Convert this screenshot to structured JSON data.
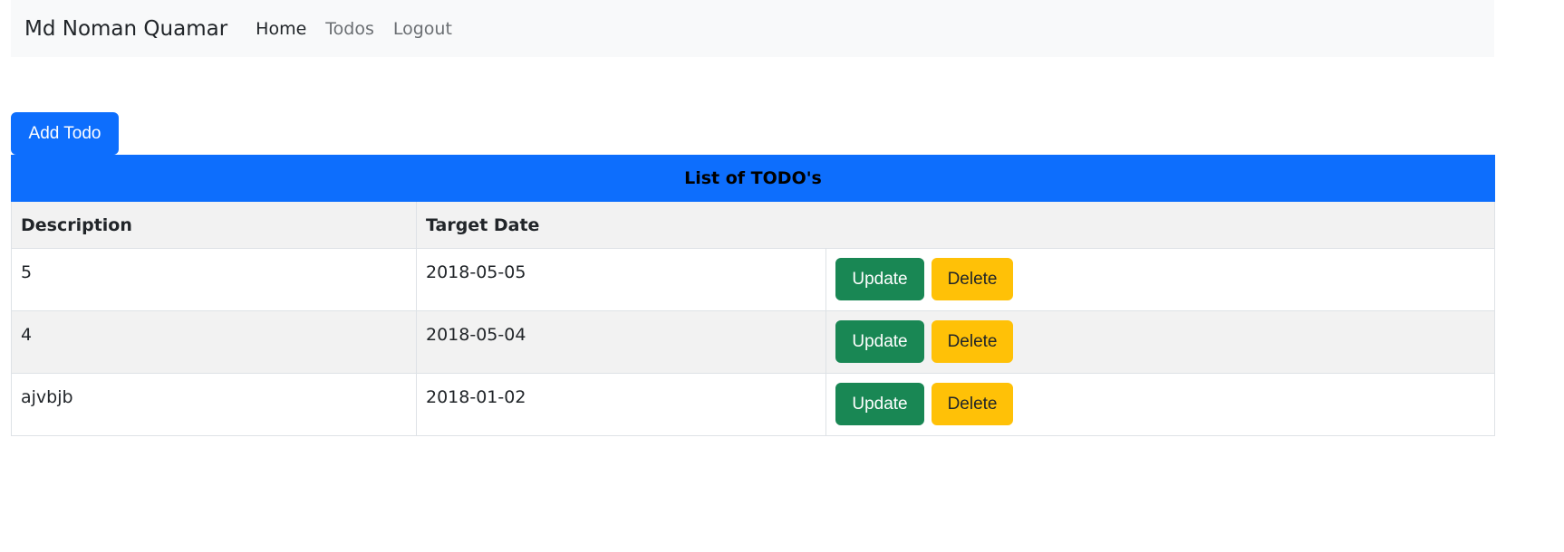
{
  "navbar": {
    "brand": "Md Noman Quamar",
    "links": [
      {
        "label": "Home",
        "active": true
      },
      {
        "label": "Todos",
        "active": false
      },
      {
        "label": "Logout",
        "active": false
      }
    ]
  },
  "add_button_label": "Add Todo",
  "table": {
    "caption": "List of TODO's",
    "columns": [
      "Description",
      "Target Date",
      ""
    ],
    "rows": [
      {
        "description": "5",
        "target_date": "2018-05-05",
        "update_label": "Update",
        "delete_label": "Delete"
      },
      {
        "description": "4",
        "target_date": "2018-05-04",
        "update_label": "Update",
        "delete_label": "Delete"
      },
      {
        "description": "ajvbjb",
        "target_date": "2018-01-02",
        "update_label": "Update",
        "delete_label": "Delete"
      }
    ]
  },
  "colors": {
    "primary": "#0d6efd",
    "success": "#198754",
    "warning": "#ffc107",
    "navbar_bg": "#f8f9fa",
    "stripe": "#f2f2f2"
  }
}
